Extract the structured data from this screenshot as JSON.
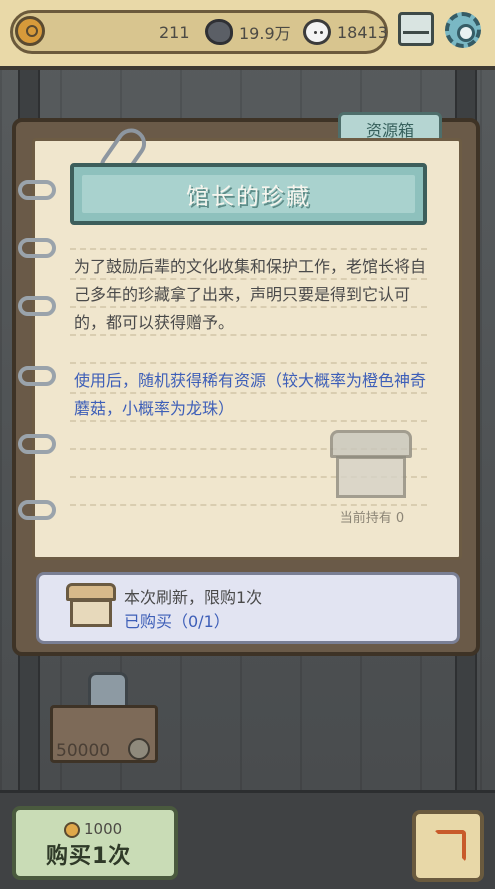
{
  "resources": {
    "medals": "211",
    "blobs": "19.9万",
    "bubbles": "18413"
  },
  "panel": {
    "tab_label": "资源箱",
    "title": "馆长的珍藏",
    "description": "为了鼓励后辈的文化收集和保护工作，老馆长将自己多年的珍藏拿了出来，声明只要是得到它认可的，都可以获得赠予。",
    "effect": "使用后，随机获得稀有资源（较大概率为橙色神奇蘑菇，小概率为龙珠）",
    "holding": "当前持有 0",
    "limit": "本次刷新，限购1次",
    "bought": "已购买（0/1）"
  },
  "bottom": {
    "sign_value": "50000",
    "price": "1000",
    "buy_label": "购买1次"
  }
}
